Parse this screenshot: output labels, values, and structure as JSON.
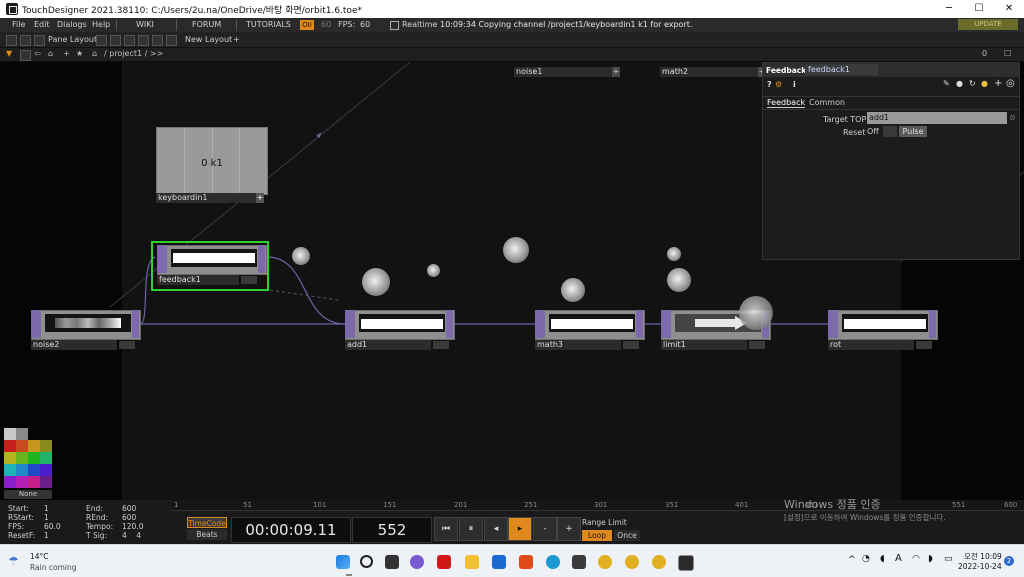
{
  "window": {
    "title": "TouchDesigner 2021.38110: C:/Users/2u.na/OneDrive/바탕 화면/orbit1.6.toe*",
    "minimize": "─",
    "maximize": "☐",
    "close": "✕"
  },
  "menu": {
    "items": [
      "File",
      "Edit",
      "Dialogs",
      "Help"
    ],
    "wiki": "WIKI",
    "forum": "FORUM",
    "tutorials": "TUTORIALS",
    "fps_badge": "OII",
    "fps_target": "60",
    "fps_label": "FPS:",
    "fps_value": "60",
    "realtime": "Realtime",
    "status": "10:09:34 Copying channel /project1/keyboardin1 k1 for export.",
    "update": "UPDATE"
  },
  "panebar": {
    "pane_layout": "Pane Layout",
    "new_layout": "New Layout",
    "plus": "+"
  },
  "pathbar": {
    "path": "/ project1 / >>",
    "right_btn_a": "0",
    "right_btn_b": "☐"
  },
  "nodes": {
    "noise1": "noise1",
    "math2": "math2",
    "keyboardin1": "keyboardin1",
    "keyboardin_value": "0 k1",
    "feedback1": "feedback1",
    "noise2": "noise2",
    "add1": "add1",
    "math3": "math3",
    "limit1": "limit1",
    "rot": "rot",
    "plus": "+"
  },
  "params": {
    "op_type": "Feedback",
    "op_name": "feedback1",
    "tab_feedback": "Feedback",
    "tab_common": "Common",
    "target_top_label": "Target TOP",
    "target_top_value": "add1",
    "reset_label": "Reset",
    "reset_off": "Off",
    "reset_pulse": "Pulse",
    "help": "?",
    "info": "i"
  },
  "palette": {
    "none_label": "None",
    "colors": [
      "#c8c8c8",
      "#8a8a8a",
      "#6a6a6a",
      "#4a4a4a",
      "#c81e1e",
      "#c86a1e",
      "#c8b41e",
      "#6ab41e",
      "#1eb41e",
      "#1eb48a",
      "#1e8ac8",
      "#1e4ac8",
      "#6a1ec8",
      "#b41eb4",
      "#c81e8a",
      "#e0e0e0"
    ]
  },
  "timeline": {
    "start_label": "Start:",
    "start_value": "1",
    "rstart_label": "RStart:",
    "rstart_value": "1",
    "fps_label": "FPS:",
    "fps_value": "60.0",
    "resetf_label": "ResetF:",
    "resetf_value": "1",
    "end_label": "End:",
    "end_value": "600",
    "rend_label": "REnd:",
    "rend_value": "600",
    "tempo_label": "Tempo:",
    "tempo_value": "120.0",
    "tsig_label": "T Sig:",
    "tsig_value": "4    4",
    "timecode": "TimeCode",
    "beats": "Beats",
    "time_display": "00:00:09.11",
    "frame_display": "552",
    "range_limit": "Range Limit",
    "loop": "Loop",
    "once": "Once",
    "ruler_ticks": [
      "1",
      "51",
      "101",
      "151",
      "201",
      "251",
      "301",
      "351",
      "401",
      "451",
      "551",
      "600"
    ],
    "btn_rewind": "⏮",
    "btn_pause": "⏸",
    "btn_back": "◂",
    "btn_play": "▸",
    "btn_minus": "-",
    "btn_plus": "+"
  },
  "watermark": {
    "line1": "Windows 정품 인증",
    "line2": "[설정]으로 이동하여 Windows를 정품 인증합니다."
  },
  "taskbar": {
    "temp": "14°C",
    "weather": "Rain coming",
    "time": "오전 10:09",
    "date": "2022-10-24",
    "ime": "A",
    "notif": "2"
  }
}
